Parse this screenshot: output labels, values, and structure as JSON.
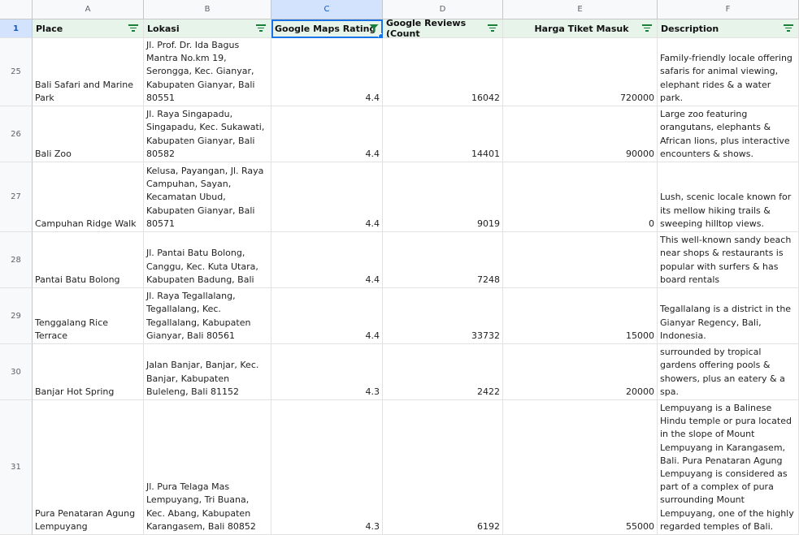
{
  "columns": [
    "A",
    "B",
    "C",
    "D",
    "E",
    "F"
  ],
  "header": {
    "row_number": "1",
    "cells": [
      "Place",
      "Lokasi",
      "Google Maps Rating",
      "Google Reviews (Count",
      "Harga Tiket Masuk",
      "Description"
    ]
  },
  "rows": [
    {
      "n": "25",
      "place": "Bali Safari and Marine Park",
      "lokasi": "Jl. Prof. Dr. Ida Bagus Mantra No.km 19, Serongga, Kec. Gianyar, Kabupaten Gianyar, Bali 80551",
      "rating": "4.4",
      "reviews": "16042",
      "harga": "720000",
      "desc": "Family-friendly locale offering safaris for animal viewing, elephant rides & a water park."
    },
    {
      "n": "26",
      "place": "Bali Zoo",
      "lokasi": "Jl. Raya Singapadu, Singapadu, Kec. Sukawati, Kabupaten Gianyar, Bali 80582",
      "rating": "4.4",
      "reviews": "14401",
      "harga": "90000",
      "desc": "Large zoo featuring orangutans, elephants & African lions, plus interactive encounters & shows."
    },
    {
      "n": "27",
      "place": "Campuhan Ridge Walk",
      "lokasi": "Kelusa, Payangan, Jl. Raya Campuhan, Sayan, Kecamatan Ubud, Kabupaten Gianyar, Bali 80571",
      "rating": "4.4",
      "reviews": "9019",
      "harga": "0",
      "desc": "Lush, scenic locale known for its mellow hiking trails & sweeping hilltop views."
    },
    {
      "n": "28",
      "place": "Pantai Batu Bolong",
      "lokasi": "Jl. Pantai Batu Bolong, Canggu, Kec. Kuta Utara, Kabupaten Badung, Bali",
      "rating": "4.4",
      "reviews": "7248",
      "harga": "",
      "desc": "This well-known sandy beach near shops & restaurants is popular with surfers & has board rentals"
    },
    {
      "n": "29",
      "place": "Tenggalang Rice Terrace",
      "lokasi": "Jl. Raya Tegallalang, Tegallalang, Kec. Tegallalang, Kabupaten Gianyar, Bali 80561",
      "rating": "4.4",
      "reviews": "33732",
      "harga": "15000",
      "desc": "Tegallalang is a district in the Gianyar Regency, Bali, Indonesia."
    },
    {
      "n": "30",
      "place": "Banjar Hot Spring",
      "lokasi": "Jalan Banjar, Banjar, Kec. Banjar, Kabupaten Buleleng, Bali 81152",
      "rating": "4.3",
      "reviews": "2422",
      "harga": "20000",
      "desc": "Hot springs complex surrounded by tropical gardens offering pools & showers, plus an eatery & a spa."
    },
    {
      "n": "31",
      "place": "Pura Penataran Agung Lempuyang",
      "lokasi": "Jl. Pura Telaga Mas Lempuyang, Tri Buana, Kec. Abang, Kabupaten Karangasem, Bali 80852",
      "rating": "4.3",
      "reviews": "6192",
      "harga": "55000",
      "desc": "Pura Penataran Agung Lempuyang is a Balinese Hindu temple or pura located in the slope of Mount Lempuyang in Karangasem, Bali. Pura Penataran Agung Lempuyang is considered as part of a complex of pura surrounding Mount Lempuyang, one of the highly regarded temples of Bali."
    }
  ],
  "colors": {
    "header_fill": "#e6f4ea",
    "filter_green": "#188038",
    "selection_blue": "#1a73e8"
  },
  "icons": {
    "filter": "filter-lines-icon",
    "active_filter": "funnel-icon"
  }
}
